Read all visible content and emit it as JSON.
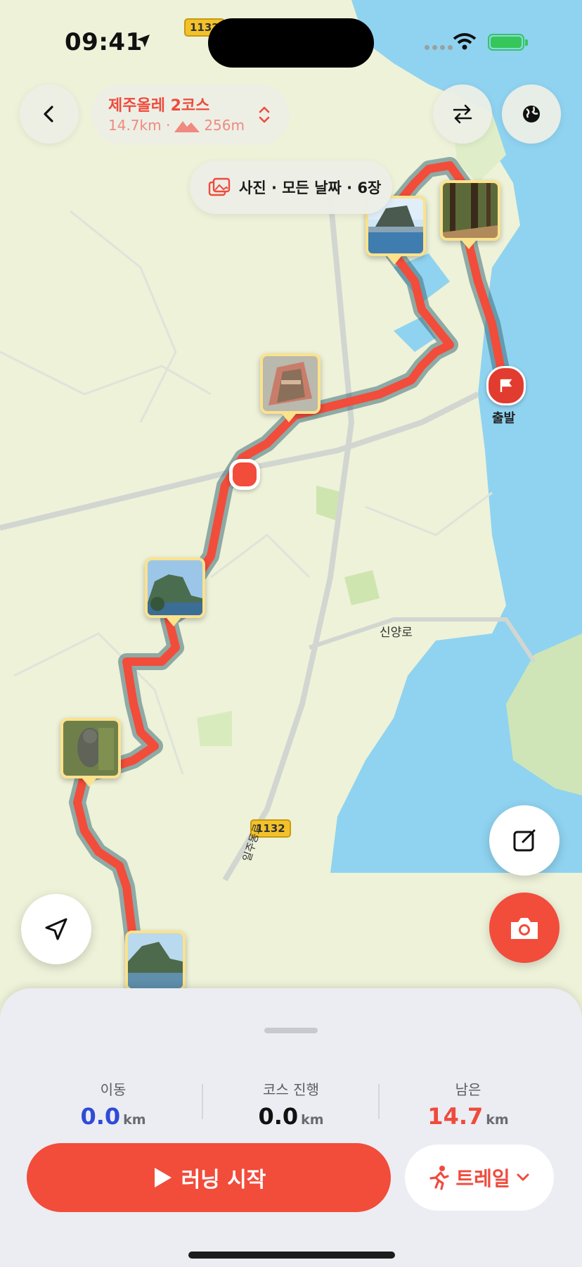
{
  "status_bar": {
    "time": "09:41"
  },
  "header": {
    "back_icon": "chevron-left-icon",
    "course_title": "제주올레 2코스",
    "distance": "14.7km ·",
    "elevation": "256m",
    "swap_icon": "swap-arrows-icon",
    "globe_icon": "globe-icon"
  },
  "filter_chip": {
    "label": "사진 · 모든 날짜 · 6장",
    "icon": "photos-icon"
  },
  "map": {
    "start_label": "출발",
    "road_label": "신양로",
    "road_vertical_label": "일주동로",
    "route_number_top": "1132",
    "route_number_mid": "1132",
    "colors": {
      "route": "#f24c3b",
      "water": "#8fd3f0",
      "land": "#eef2d9",
      "photo_border": "#fbe28c"
    }
  },
  "buttons": {
    "locate_icon": "navigation-arrow-icon",
    "edit_icon": "edit-note-icon",
    "camera_icon": "camera-icon"
  },
  "sheet": {
    "stats": [
      {
        "label": "이동",
        "value": "0.0",
        "unit": "km",
        "color": "#2f4bd8"
      },
      {
        "label": "코스 진행",
        "value": "0.0",
        "unit": "km",
        "color": "#111111"
      },
      {
        "label": "남은",
        "value": "14.7",
        "unit": "km",
        "color": "#ef4b3d"
      }
    ],
    "start_button": "러닝 시작",
    "mode_button": "트레일",
    "start_icon": "play-icon",
    "mode_icon": "running-person-icon"
  }
}
